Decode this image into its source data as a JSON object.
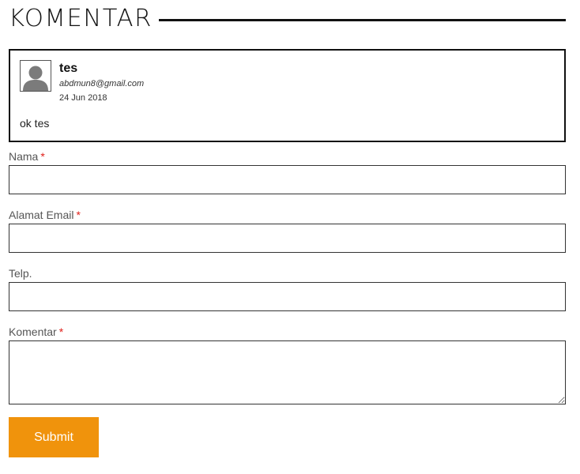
{
  "section": {
    "title": "KOMENTAR"
  },
  "comment": {
    "author": "tes",
    "email": "abdmun8@gmail.com",
    "date": "24 Jun 2018",
    "text": "ok tes",
    "avatar_icon": "user-silhouette-icon"
  },
  "form": {
    "required_marker": "*",
    "name": {
      "label": "Nama",
      "value": "",
      "placeholder": ""
    },
    "email": {
      "label": "Alamat Email",
      "value": "",
      "placeholder": ""
    },
    "phone": {
      "label": "Telp.",
      "value": "",
      "placeholder": ""
    },
    "comment": {
      "label": "Komentar",
      "value": "",
      "placeholder": ""
    },
    "submit_label": "Submit"
  },
  "colors": {
    "accent": "#f0930c",
    "required": "#e0201b",
    "border": "#111111"
  }
}
